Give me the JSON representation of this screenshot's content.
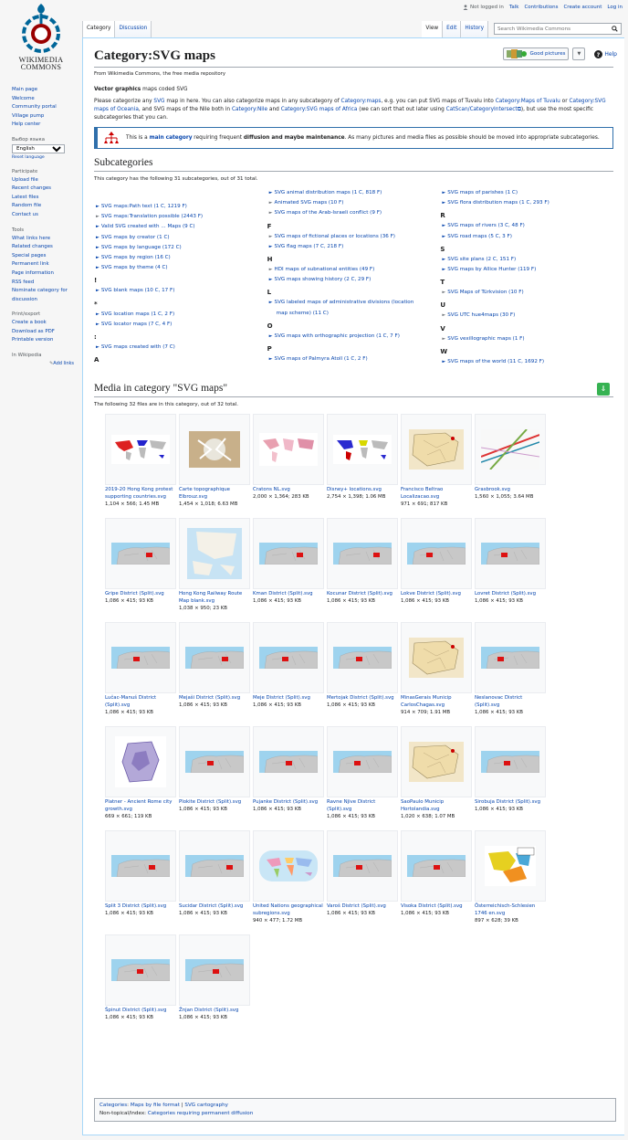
{
  "personal": {
    "notlogged": "Not logged in",
    "talk": "Talk",
    "contrib": "Contributions",
    "create": "Create account",
    "login": "Log in"
  },
  "logo": {
    "line1": "WIKIMEDIA",
    "line2": "COMMONS"
  },
  "nav": [
    "Main page",
    "Welcome",
    "Community portal",
    "Village pump",
    "Help center"
  ],
  "lang": {
    "heading": "Выбор языка",
    "selected": "English",
    "reset": "Reset language"
  },
  "participate": {
    "heading": "Participate",
    "items": [
      "Upload file",
      "Recent changes",
      "Latest files",
      "Random file",
      "Contact us"
    ]
  },
  "tools": {
    "heading": "Tools",
    "items": [
      "What links here",
      "Related changes",
      "Special pages",
      "Permanent link",
      "Page information",
      "RSS feed",
      "Nominate category for discussion"
    ]
  },
  "print": {
    "heading": "Print/export",
    "items": [
      "Create a book",
      "Download as PDF",
      "Printable version"
    ]
  },
  "inwiki": {
    "heading": "In Wikipedia",
    "add": "Add links"
  },
  "tabs": {
    "category": "Category",
    "discussion": "Discussion",
    "view": "View",
    "edit": "Edit",
    "history": "History"
  },
  "search": {
    "placeholder": "Search Wikimedia Commons"
  },
  "goodpics": "Good pictures",
  "help": "Help",
  "title": "Category:SVG maps",
  "subtitle": "From Wikimedia Commons, the free media repository",
  "intro1_bold": "Vector graphics",
  "intro1_rest": " maps coded SVG",
  "intro2": {
    "a": "Please categorize any ",
    "svg": "SVG",
    "b": " map in here. You can also categorize maps in any subcategory of ",
    "cm": "Category:maps",
    "c": ", e.g. you can put SVG maps of Tuvalu into ",
    "tuv": "Category:Maps of Tuvalu",
    "d": " or ",
    "oce": "Category:SVG maps of Oceania",
    "e": ", and SVG maps of the Nile both in ",
    "nile": "Category:Nile",
    "f": " and ",
    "afr": "Category:SVG maps of Africa",
    "g": " (we can sort that out later using ",
    "cat": "CatScan/CategoryIntersect",
    "h": "), but use the most specific subcategories that you can."
  },
  "box": {
    "a": "This is a ",
    "b": "main category",
    "c": " requiring frequent ",
    "d": "diffusion and maybe maintenance",
    "e": ". As many pictures and media files as possible should be moved into appropriate subcategories."
  },
  "subcats": {
    "heading": "Subcategories",
    "count": "This category has the following 31 subcategories, out of 31 total.",
    "col1": [
      {
        "t": "item",
        "v": "SVG maps:Path text (1 C, 1219 F)"
      },
      {
        "t": "grey",
        "v": "SVG maps:Translation possible (2443 F)"
      },
      {
        "t": "item",
        "v": "Valid SVG created with ... Maps (9 C)"
      },
      {
        "t": "item",
        "v": "SVG maps by creator (1 C)"
      },
      {
        "t": "item",
        "v": "SVG maps by language (172 C)"
      },
      {
        "t": "item",
        "v": "SVG maps by region (16 C)"
      },
      {
        "t": "item",
        "v": "SVG maps by theme (4 C)"
      },
      {
        "t": "letter",
        "v": "!"
      },
      {
        "t": "item",
        "v": "SVG blank maps (10 C, 17 F)"
      },
      {
        "t": "letter",
        "v": "*"
      },
      {
        "t": "item",
        "v": "SVG location maps (1 C, 2 F)"
      },
      {
        "t": "item",
        "v": "SVG locator maps (7 C, 4 F)"
      },
      {
        "t": "letter",
        "v": ":"
      },
      {
        "t": "item",
        "v": "SVG maps created with (7 C)"
      },
      {
        "t": "letter",
        "v": "A"
      }
    ],
    "col2": [
      {
        "t": "item",
        "v": "SVG animal distribution maps (1 C, 818 F)"
      },
      {
        "t": "grey",
        "v": "Animated SVG maps (10 F)"
      },
      {
        "t": "grey",
        "v": "SVG maps of the Arab-Israeli conflict (9 F)"
      },
      {
        "t": "letter",
        "v": "F"
      },
      {
        "t": "grey",
        "v": "SVG maps of fictional places or locations (36 F)"
      },
      {
        "t": "item",
        "v": "SVG flag maps (7 C, 218 F)"
      },
      {
        "t": "letter",
        "v": "H"
      },
      {
        "t": "grey",
        "v": "HDI maps of subnational entities (49 F)"
      },
      {
        "t": "item",
        "v": "SVG maps showing history (2 C, 29 F)"
      },
      {
        "t": "letter",
        "v": "L"
      },
      {
        "t": "item",
        "v": "SVG labeled maps of administrative divisions (location"
      },
      {
        "t": "cont",
        "v": "map scheme) (11 C)"
      },
      {
        "t": "letter",
        "v": "O"
      },
      {
        "t": "item",
        "v": "SVG maps with orthographic projection (1 C, 7 F)"
      },
      {
        "t": "letter",
        "v": "P"
      },
      {
        "t": "item",
        "v": "SVG maps of Palmyra Atoll (1 C, 2 F)"
      }
    ],
    "col3": [
      {
        "t": "item",
        "v": "SVG maps of parishes (1 C)"
      },
      {
        "t": "item",
        "v": "SVG flora distribution maps (1 C, 293 F)"
      },
      {
        "t": "letter",
        "v": "R"
      },
      {
        "t": "item",
        "v": "SVG maps of rivers (3 C, 48 F)"
      },
      {
        "t": "item",
        "v": "SVG road maps (5 C, 3 F)"
      },
      {
        "t": "letter",
        "v": "S"
      },
      {
        "t": "item",
        "v": "SVG site plans (2 C, 151 F)"
      },
      {
        "t": "item",
        "v": "SVG maps by Allice Hunter (119 F)"
      },
      {
        "t": "letter",
        "v": "T"
      },
      {
        "t": "grey",
        "v": "SVG Maps of Türkvision (10 F)"
      },
      {
        "t": "letter",
        "v": "U"
      },
      {
        "t": "grey",
        "v": "SVG UTC hue4maps (30 F)"
      },
      {
        "t": "letter",
        "v": "V"
      },
      {
        "t": "grey",
        "v": "SVG vexillographic maps (1 F)"
      },
      {
        "t": "letter",
        "v": "W"
      },
      {
        "t": "item",
        "v": "SVG maps of the world (11 C, 1692 F)"
      }
    ]
  },
  "media": {
    "heading": "Media in category \"SVG maps\"",
    "count": "The following 32 files are in this category, out of 32 total.",
    "files": [
      {
        "n": "2019-20 Hong Kong protest supporting countries.svg",
        "d": "1,104 × 566; 1.45 MB",
        "k": "world1"
      },
      {
        "n": "Carte topographique Elbrouz.svg",
        "d": "1,454 × 1,018; 6.63 MB",
        "k": "topo"
      },
      {
        "n": "Cratons NL.svg",
        "d": "2,000 × 1,364; 283 KB",
        "k": "pink"
      },
      {
        "n": "Disney+ locations.svg",
        "d": "2,754 × 1,398; 1.06 MB",
        "k": "world2"
      },
      {
        "n": "Francisco Beltrao Localizacao.svg",
        "d": "971 × 691; 817 KB",
        "k": "beige"
      },
      {
        "n": "Grasbrook.svg",
        "d": "1,560 × 1,055; 3.64 MB",
        "k": "lines"
      },
      {
        "n": "Gripe District (Split).svg",
        "d": "1,086 × 415; 93 KB",
        "k": "split"
      },
      {
        "n": "Hong Kong Railway Route Map blank.svg",
        "d": "1,038 × 950; 23 KB",
        "k": "hk"
      },
      {
        "n": "Kman District (Split).svg",
        "d": "1,086 × 415; 93 KB",
        "k": "split"
      },
      {
        "n": "Kocunar District (Split).svg",
        "d": "1,086 × 415; 93 KB",
        "k": "split"
      },
      {
        "n": "Lokve District (Split).svg",
        "d": "1,086 × 415; 93 KB",
        "k": "split"
      },
      {
        "n": "Lovret District (Split).svg",
        "d": "1,086 × 415; 93 KB",
        "k": "split"
      },
      {
        "n": "Lučac-Manuš District (Split).svg",
        "d": "1,086 × 415; 93 KB",
        "k": "split"
      },
      {
        "n": "Mejaši District (Split).svg",
        "d": "1,086 × 415; 93 KB",
        "k": "split"
      },
      {
        "n": "Meje District (Split).svg",
        "d": "1,086 × 415; 93 KB",
        "k": "split"
      },
      {
        "n": "Mertojak District (Split).svg",
        "d": "1,086 × 415; 93 KB",
        "k": "split"
      },
      {
        "n": "MinasGerais Municip CarlosChagas.svg",
        "d": "914 × 709; 1.91 MB",
        "k": "beige"
      },
      {
        "n": "Neslanovac District (Split).svg",
        "d": "1,086 × 415; 93 KB",
        "k": "split"
      },
      {
        "n": "Platner - Ancient Rome city growth.svg",
        "d": "669 × 661; 119 KB",
        "k": "rome"
      },
      {
        "n": "Plokite District (Split).svg",
        "d": "1,086 × 415; 93 KB",
        "k": "split"
      },
      {
        "n": "Pujanke District (Split).svg",
        "d": "1,086 × 415; 93 KB",
        "k": "split"
      },
      {
        "n": "Ravne Njive District (Split).svg",
        "d": "1,086 × 415; 93 KB",
        "k": "split"
      },
      {
        "n": "SaoPaulo Municip Hortolandia.svg",
        "d": "1,020 × 638; 1.07 MB",
        "k": "beige"
      },
      {
        "n": "Sirobuja District (Split).svg",
        "d": "1,086 × 415; 93 KB",
        "k": "split"
      },
      {
        "n": "Split 3 District (Split).svg",
        "d": "1,086 × 415; 93 KB",
        "k": "split"
      },
      {
        "n": "Sucidar District (Split).svg",
        "d": "1,086 × 415; 93 KB",
        "k": "split"
      },
      {
        "n": "United Nations geographical subregions.svg",
        "d": "940 × 477; 1.72 MB",
        "k": "un"
      },
      {
        "n": "Varoš District (Split).svg",
        "d": "1,086 × 415; 93 KB",
        "k": "split"
      },
      {
        "n": "Visoka District (Split).svg",
        "d": "1,086 × 415; 93 KB",
        "k": "split"
      },
      {
        "n": "Österreichisch-Schlesien 1746 en.svg",
        "d": "897 × 628; 39 KB",
        "k": "aus"
      },
      {
        "n": "Špinut District (Split).svg",
        "d": "1,086 × 415; 93 KB",
        "k": "split"
      },
      {
        "n": "Žnjan District (Split).svg",
        "d": "1,086 × 415; 93 KB",
        "k": "split"
      }
    ]
  },
  "catlinks": {
    "label": "Categories",
    "c1": "Maps by file format",
    "c2": "SVG cartography",
    "hidden": "Non-topical/index:",
    "h1": "Categories requiring permanent diffusion"
  }
}
